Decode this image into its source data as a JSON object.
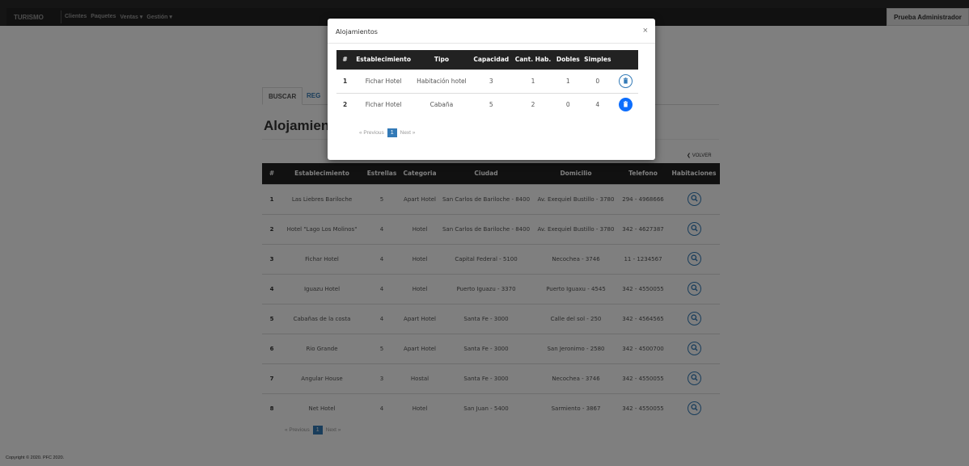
{
  "navbar": {
    "brand": "TURISMO",
    "links": [
      "Clientes",
      "Paquetes",
      "Ventas ▾",
      "Gestión ▾"
    ],
    "user": "Prueba Administrador"
  },
  "tabs": {
    "search": "BUSCAR",
    "register": "REG"
  },
  "page_title": "Alojamient",
  "back_label": "❮ VOLVER",
  "table": {
    "headers": [
      "#",
      "Establecimiento",
      "Estrellas",
      "Categoria",
      "Ciudad",
      "Domicilio",
      "Telefono",
      "Habitaciones"
    ],
    "rows": [
      {
        "num": "1",
        "name": "Las Liebres Bariloche",
        "stars": "5",
        "category": "Apart Hotel",
        "city": "San Carlos de Bariloche - 8400",
        "address": "Av. Exequiel Bustillo - 3780",
        "phone": "294 - 4968666"
      },
      {
        "num": "2",
        "name": "Hotel \"Lago Los Molinos\"",
        "stars": "4",
        "category": "Hotel",
        "city": "San Carlos de Bariloche - 8400",
        "address": "Av. Exequiel Bustillo - 3780",
        "phone": "342 - 4627387"
      },
      {
        "num": "3",
        "name": "Fichar Hotel",
        "stars": "4",
        "category": "Hotel",
        "city": "Capital Federal - 5100",
        "address": "Necochea - 3746",
        "phone": "11 - 1234567"
      },
      {
        "num": "4",
        "name": "Iguazu Hotel",
        "stars": "4",
        "category": "Hotel",
        "city": "Puerto Iguazu - 3370",
        "address": "Puerto Iguaxu - 4545",
        "phone": "342 - 4550055"
      },
      {
        "num": "5",
        "name": "Cabañas de la costa",
        "stars": "4",
        "category": "Apart Hotel",
        "city": "Santa Fe - 3000",
        "address": "Calle del sol - 250",
        "phone": "342 - 4564565"
      },
      {
        "num": "6",
        "name": "Rio Grande",
        "stars": "5",
        "category": "Apart Hotel",
        "city": "Santa Fe - 3000",
        "address": "San Jeronimo - 2580",
        "phone": "342 - 4500700"
      },
      {
        "num": "7",
        "name": "Angular House",
        "stars": "3",
        "category": "Hostal",
        "city": "Santa Fe - 3000",
        "address": "Necochea - 3746",
        "phone": "342 - 4550055"
      },
      {
        "num": "8",
        "name": "Net Hotel",
        "stars": "4",
        "category": "Hotel",
        "city": "San Juan - 5400",
        "address": "Sarmiento - 3867",
        "phone": "342 - 4550055"
      }
    ]
  },
  "pager": {
    "previous": "« Previous",
    "current": "1",
    "next": "Next »"
  },
  "copyright": "Copyright © 2020. PFC 2020.",
  "modal": {
    "title": "Alojamientos",
    "close": "×",
    "headers": [
      "#",
      "Establecimiento",
      "Tipo",
      "Capacidad",
      "Cant. Hab.",
      "Dobles",
      "Simples",
      ""
    ],
    "rows": [
      {
        "num": "1",
        "name": "Fichar Hotel",
        "type": "Habitación hotel",
        "capacity": "3",
        "rooms": "1",
        "doubles": "1",
        "singles": "0"
      },
      {
        "num": "2",
        "name": "Fichar Hotel",
        "type": "Cabaña",
        "capacity": "5",
        "rooms": "2",
        "doubles": "0",
        "singles": "4"
      }
    ]
  },
  "colors": {
    "primary": "#337ab7",
    "dark": "#222222",
    "overlay": "rgba(0,0,0,0.5)"
  },
  "icons": {
    "search": "search-icon",
    "delete": "trash-icon"
  }
}
